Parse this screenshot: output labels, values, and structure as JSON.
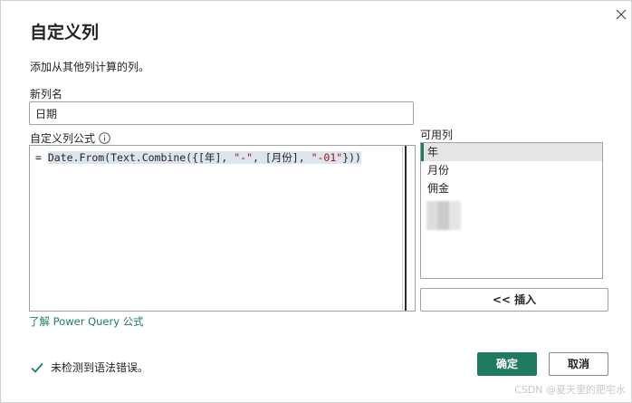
{
  "dialog": {
    "title": "自定义列",
    "subtitle": "添加从其他列计算的列。"
  },
  "name_field": {
    "label": "新列名",
    "value": "日期"
  },
  "formula": {
    "label": "自定义列公式",
    "prefix": "= ",
    "code_a": "Date.From(Text.Combine({[年], ",
    "str1": "\"-\"",
    "code_b": ", [月份], ",
    "str2": "\"-01\"",
    "code_c": "}))"
  },
  "available_columns": {
    "label": "可用列",
    "items": [
      "年",
      "月份",
      "佣金"
    ],
    "selected": "年"
  },
  "insert_button": "<< 插入",
  "learn_link": "了解 Power Query 公式",
  "status": "未检测到语法错误。",
  "ok_button": "确定",
  "cancel_button": "取消",
  "watermark": "CSDN @夏天里的肥宅水",
  "colors": {
    "accent": "#1f7a62",
    "selection": "#e5e5e5"
  }
}
